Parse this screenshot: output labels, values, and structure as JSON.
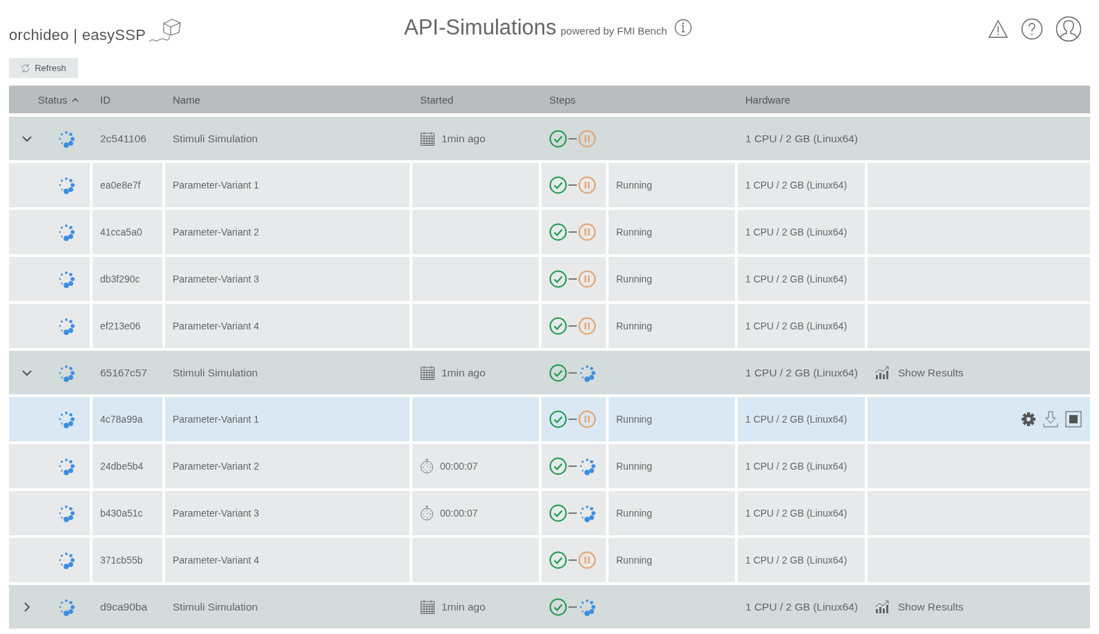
{
  "logo": {
    "text": "orchideo | easySSP"
  },
  "header": {
    "title": "API-Simulations",
    "subtitle": "powered by FMI Bench"
  },
  "toolbar": {
    "refresh": "Refresh"
  },
  "table": {
    "columns": [
      {
        "label": "Status",
        "sorted": true
      },
      {
        "label": "ID",
        "sorted": false
      },
      {
        "label": "Name",
        "sorted": false
      },
      {
        "label": "Started",
        "sorted": false
      },
      {
        "label": "Steps",
        "sorted": false
      },
      {
        "label": "Hardware",
        "sorted": false
      }
    ],
    "groups": [
      {
        "expanded": true,
        "status": {
          "kind": "running"
        },
        "id": "2c541106",
        "name": "Stimuli Simulation",
        "started": {
          "kind": "calendar",
          "text": "1min ago"
        },
        "steps": [
          {
            "kind": "done"
          },
          {
            "kind": "paused"
          }
        ],
        "hardware": "1 CPU / 2 GB (Linux64)",
        "children": [
          {
            "selected": false,
            "status": {
              "kind": "running"
            },
            "id": "ea0e8e7f",
            "name": "Parameter-Variant 1",
            "steps": [
              {
                "kind": "done"
              },
              {
                "kind": "paused"
              }
            ],
            "state": "Running",
            "hardware": "1 CPU / 2 GB (Linux64)"
          },
          {
            "selected": false,
            "status": {
              "kind": "running"
            },
            "id": "41cca5a0",
            "name": "Parameter-Variant 2",
            "steps": [
              {
                "kind": "done"
              },
              {
                "kind": "paused"
              }
            ],
            "state": "Running",
            "hardware": "1 CPU / 2 GB (Linux64)"
          },
          {
            "selected": false,
            "status": {
              "kind": "running"
            },
            "id": "db3f290c",
            "name": "Parameter-Variant 3",
            "steps": [
              {
                "kind": "done"
              },
              {
                "kind": "paused"
              }
            ],
            "state": "Running",
            "hardware": "1 CPU / 2 GB (Linux64)"
          },
          {
            "selected": false,
            "status": {
              "kind": "running"
            },
            "id": "ef213e06",
            "name": "Parameter-Variant 4",
            "steps": [
              {
                "kind": "done"
              },
              {
                "kind": "paused"
              }
            ],
            "state": "Running",
            "hardware": "1 CPU / 2 GB (Linux64)"
          }
        ]
      },
      {
        "expanded": true,
        "status": {
          "kind": "running"
        },
        "id": "65167c57",
        "name": "Stimuli Simulation",
        "started": {
          "kind": "calendar",
          "text": "1min ago"
        },
        "steps": [
          {
            "kind": "done"
          },
          {
            "kind": "running"
          }
        ],
        "hardware": "1 CPU / 2 GB (Linux64)",
        "results": "Show Results",
        "children": [
          {
            "selected": true,
            "status": {
              "kind": "running"
            },
            "id": "4c78a99a",
            "name": "Parameter-Variant 1",
            "steps": [
              {
                "kind": "done"
              },
              {
                "kind": "paused"
              }
            ],
            "state": "Running",
            "hardware": "1 CPU / 2 GB (Linux64)"
          },
          {
            "selected": false,
            "status": {
              "kind": "running"
            },
            "id": "24dbe5b4",
            "name": "Parameter-Variant 2",
            "started": {
              "kind": "timer",
              "text": "00:00:07"
            },
            "steps": [
              {
                "kind": "done"
              },
              {
                "kind": "running"
              }
            ],
            "state": "Running",
            "hardware": "1 CPU / 2 GB (Linux64)"
          },
          {
            "selected": false,
            "status": {
              "kind": "running"
            },
            "id": "b430a51c",
            "name": "Parameter-Variant 3",
            "started": {
              "kind": "timer",
              "text": "00:00:07"
            },
            "steps": [
              {
                "kind": "done"
              },
              {
                "kind": "running"
              }
            ],
            "state": "Running",
            "hardware": "1 CPU / 2 GB (Linux64)"
          },
          {
            "selected": false,
            "status": {
              "kind": "running"
            },
            "id": "371cb55b",
            "name": "Parameter-Variant 4",
            "steps": [
              {
                "kind": "done"
              },
              {
                "kind": "paused"
              }
            ],
            "state": "Running",
            "hardware": "1 CPU / 2 GB (Linux64)"
          }
        ]
      },
      {
        "expanded": false,
        "status": {
          "kind": "running"
        },
        "id": "d9ca90ba",
        "name": "Stimuli Simulation",
        "started": {
          "kind": "calendar",
          "text": "1min ago"
        },
        "steps": [
          {
            "kind": "done"
          },
          {
            "kind": "running"
          }
        ],
        "hardware": "1 CPU / 2 GB (Linux64)",
        "results": "Show Results"
      }
    ]
  }
}
